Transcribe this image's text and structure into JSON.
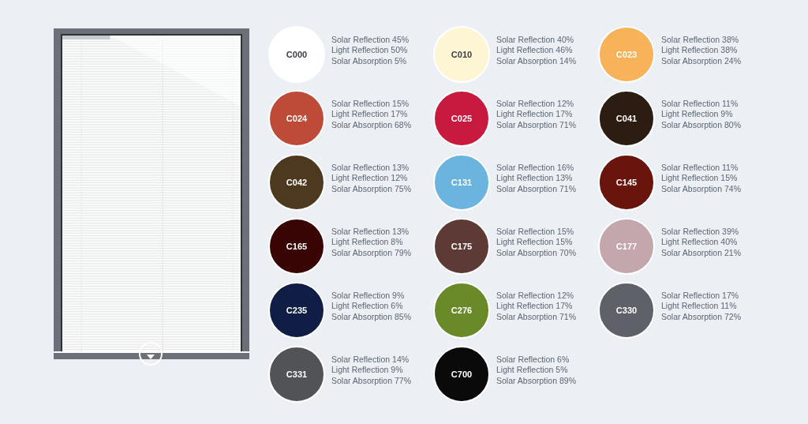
{
  "swatches": [
    {
      "code": "C000",
      "color": "#ffffff",
      "lines": [
        "Solar Reflection 45%",
        "Light Reflection 50%",
        "Solar Absorption 5%"
      ]
    },
    {
      "code": "C010",
      "color": "#fdf5d3",
      "lines": [
        "Solar Reflection 40%",
        "Light Reflection 46%",
        "Solar Absorption 14%"
      ]
    },
    {
      "code": "C023",
      "color": "#f8b35a",
      "lines": [
        "Solar Reflection 38%",
        "Light Reflection 38%",
        "Solar Absorption 24%"
      ]
    },
    {
      "code": "C024",
      "color": "#bd4b38",
      "lines": [
        "Solar Reflection 15%",
        "Light Reflection 17%",
        "Solar Absorption 68%"
      ]
    },
    {
      "code": "C025",
      "color": "#c8193f",
      "lines": [
        "Solar Reflection 12%",
        "Light Reflection 17%",
        "Solar Absorption 71%"
      ]
    },
    {
      "code": "C041",
      "color": "#2c1c12",
      "lines": [
        "Solar Reflection 11%",
        "Light Reflection 9%",
        "Solar Absorption 80%"
      ]
    },
    {
      "code": "C042",
      "color": "#4d3820",
      "lines": [
        "Solar Reflection 13%",
        "Light Reflection 12%",
        "Solar Absorption 75%"
      ]
    },
    {
      "code": "C131",
      "color": "#6cb4e0",
      "lines": [
        "Solar Reflection 16%",
        "Light Reflection 13%",
        "Solar Absorption 71%"
      ]
    },
    {
      "code": "C145",
      "color": "#6a140e",
      "lines": [
        "Solar Reflection 11%",
        "Light Reflection 15%",
        "Solar Absorption 74%"
      ]
    },
    {
      "code": "C165",
      "color": "#380404",
      "lines": [
        "Solar Reflection 13%",
        "Light Reflection 8%",
        "Solar Absorption 79%"
      ]
    },
    {
      "code": "C175",
      "color": "#5e3a36",
      "lines": [
        "Solar Reflection 15%",
        "Light Reflection 15%",
        "Solar Absorption 70%"
      ]
    },
    {
      "code": "C177",
      "color": "#c4a6ad",
      "lines": [
        "Solar Reflection 39%",
        "Light Reflection 40%",
        "Solar Absorption 21%"
      ]
    },
    {
      "code": "C235",
      "color": "#101e46",
      "lines": [
        "Solar Reflection 9%",
        "Light Reflection 6%",
        "Solar Absorption 85%"
      ]
    },
    {
      "code": "C276",
      "color": "#6a8a2a",
      "lines": [
        "Solar Reflection 12%",
        "Light Reflection 17%",
        "Solar Absorption 71%"
      ]
    },
    {
      "code": "C330",
      "color": "#5e6168",
      "lines": [
        "Solar Reflection 17%",
        "Light Reflection 11%",
        "Solar Absorption 72%"
      ]
    },
    {
      "code": "C331",
      "color": "#525357",
      "lines": [
        "Solar Reflection 14%",
        "Light Reflection 9%",
        "Solar Absorption 77%"
      ]
    },
    {
      "code": "C700",
      "color": "#0a0a0a",
      "lines": [
        "Solar Reflection 6%",
        "Light Reflection 5%",
        "Solar Absorption 89%"
      ]
    }
  ]
}
